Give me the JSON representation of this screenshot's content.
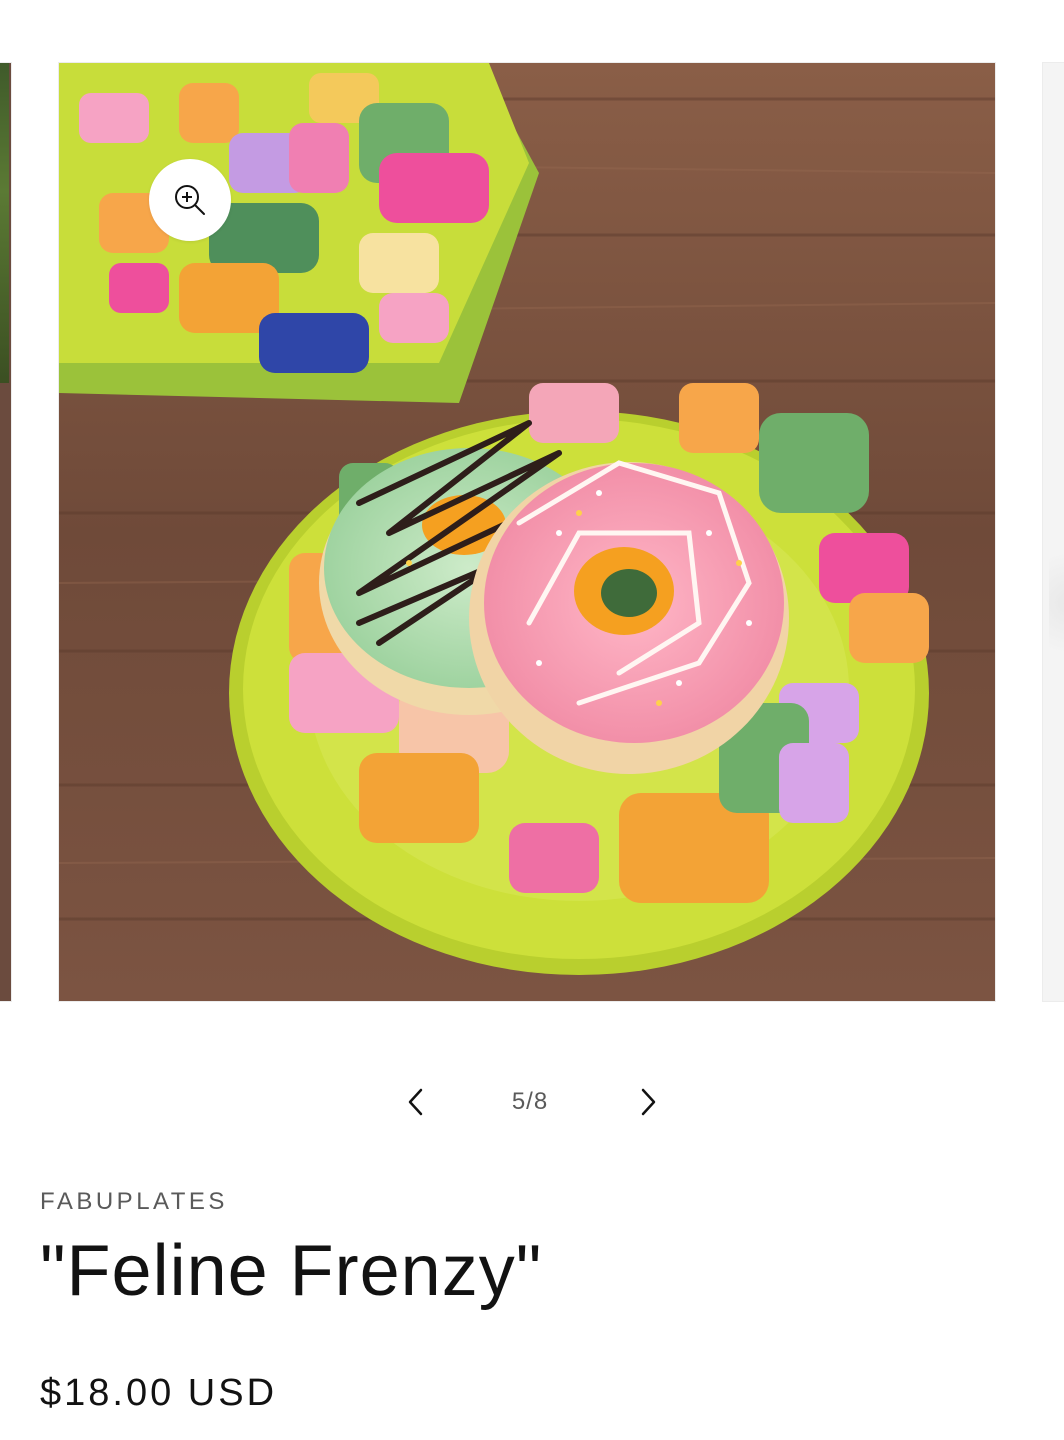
{
  "gallery": {
    "current_image_alt": "Feline Frenzy paper plate with donuts and matching napkins on a wooden table",
    "zoom_icon": "zoom-in-icon",
    "counter": "5/8",
    "prev_icon": "chevron-left-icon",
    "next_icon": "chevron-right-icon"
  },
  "product": {
    "vendor": "FABUPLATES",
    "title": "\"Feline Frenzy\"",
    "price": "$18.00 USD"
  },
  "colors": {
    "text": "#121212",
    "muted": "#5a5a5a",
    "plate": "#c8dd3a",
    "wood": "#7a5240"
  }
}
